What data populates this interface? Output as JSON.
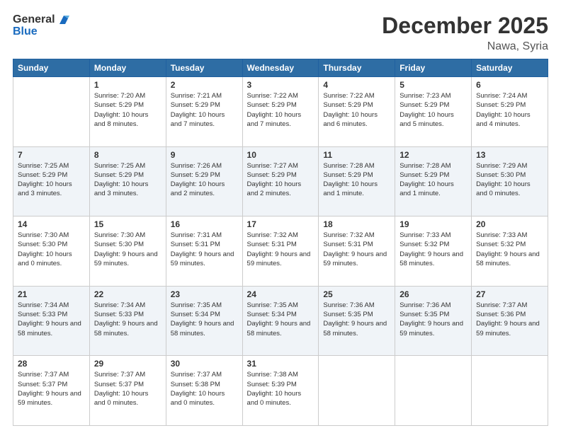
{
  "header": {
    "logo_line1": "General",
    "logo_line2": "Blue",
    "title": "December 2025",
    "location": "Nawa, Syria"
  },
  "weekdays": [
    "Sunday",
    "Monday",
    "Tuesday",
    "Wednesday",
    "Thursday",
    "Friday",
    "Saturday"
  ],
  "weeks": [
    [
      {
        "day": "",
        "sunrise": "",
        "sunset": "",
        "daylight": ""
      },
      {
        "day": "1",
        "sunrise": "Sunrise: 7:20 AM",
        "sunset": "Sunset: 5:29 PM",
        "daylight": "Daylight: 10 hours and 8 minutes."
      },
      {
        "day": "2",
        "sunrise": "Sunrise: 7:21 AM",
        "sunset": "Sunset: 5:29 PM",
        "daylight": "Daylight: 10 hours and 7 minutes."
      },
      {
        "day": "3",
        "sunrise": "Sunrise: 7:22 AM",
        "sunset": "Sunset: 5:29 PM",
        "daylight": "Daylight: 10 hours and 7 minutes."
      },
      {
        "day": "4",
        "sunrise": "Sunrise: 7:22 AM",
        "sunset": "Sunset: 5:29 PM",
        "daylight": "Daylight: 10 hours and 6 minutes."
      },
      {
        "day": "5",
        "sunrise": "Sunrise: 7:23 AM",
        "sunset": "Sunset: 5:29 PM",
        "daylight": "Daylight: 10 hours and 5 minutes."
      },
      {
        "day": "6",
        "sunrise": "Sunrise: 7:24 AM",
        "sunset": "Sunset: 5:29 PM",
        "daylight": "Daylight: 10 hours and 4 minutes."
      }
    ],
    [
      {
        "day": "7",
        "sunrise": "Sunrise: 7:25 AM",
        "sunset": "Sunset: 5:29 PM",
        "daylight": "Daylight: 10 hours and 3 minutes."
      },
      {
        "day": "8",
        "sunrise": "Sunrise: 7:25 AM",
        "sunset": "Sunset: 5:29 PM",
        "daylight": "Daylight: 10 hours and 3 minutes."
      },
      {
        "day": "9",
        "sunrise": "Sunrise: 7:26 AM",
        "sunset": "Sunset: 5:29 PM",
        "daylight": "Daylight: 10 hours and 2 minutes."
      },
      {
        "day": "10",
        "sunrise": "Sunrise: 7:27 AM",
        "sunset": "Sunset: 5:29 PM",
        "daylight": "Daylight: 10 hours and 2 minutes."
      },
      {
        "day": "11",
        "sunrise": "Sunrise: 7:28 AM",
        "sunset": "Sunset: 5:29 PM",
        "daylight": "Daylight: 10 hours and 1 minute."
      },
      {
        "day": "12",
        "sunrise": "Sunrise: 7:28 AM",
        "sunset": "Sunset: 5:29 PM",
        "daylight": "Daylight: 10 hours and 1 minute."
      },
      {
        "day": "13",
        "sunrise": "Sunrise: 7:29 AM",
        "sunset": "Sunset: 5:30 PM",
        "daylight": "Daylight: 10 hours and 0 minutes."
      }
    ],
    [
      {
        "day": "14",
        "sunrise": "Sunrise: 7:30 AM",
        "sunset": "Sunset: 5:30 PM",
        "daylight": "Daylight: 10 hours and 0 minutes."
      },
      {
        "day": "15",
        "sunrise": "Sunrise: 7:30 AM",
        "sunset": "Sunset: 5:30 PM",
        "daylight": "Daylight: 9 hours and 59 minutes."
      },
      {
        "day": "16",
        "sunrise": "Sunrise: 7:31 AM",
        "sunset": "Sunset: 5:31 PM",
        "daylight": "Daylight: 9 hours and 59 minutes."
      },
      {
        "day": "17",
        "sunrise": "Sunrise: 7:32 AM",
        "sunset": "Sunset: 5:31 PM",
        "daylight": "Daylight: 9 hours and 59 minutes."
      },
      {
        "day": "18",
        "sunrise": "Sunrise: 7:32 AM",
        "sunset": "Sunset: 5:31 PM",
        "daylight": "Daylight: 9 hours and 59 minutes."
      },
      {
        "day": "19",
        "sunrise": "Sunrise: 7:33 AM",
        "sunset": "Sunset: 5:32 PM",
        "daylight": "Daylight: 9 hours and 58 minutes."
      },
      {
        "day": "20",
        "sunrise": "Sunrise: 7:33 AM",
        "sunset": "Sunset: 5:32 PM",
        "daylight": "Daylight: 9 hours and 58 minutes."
      }
    ],
    [
      {
        "day": "21",
        "sunrise": "Sunrise: 7:34 AM",
        "sunset": "Sunset: 5:33 PM",
        "daylight": "Daylight: 9 hours and 58 minutes."
      },
      {
        "day": "22",
        "sunrise": "Sunrise: 7:34 AM",
        "sunset": "Sunset: 5:33 PM",
        "daylight": "Daylight: 9 hours and 58 minutes."
      },
      {
        "day": "23",
        "sunrise": "Sunrise: 7:35 AM",
        "sunset": "Sunset: 5:34 PM",
        "daylight": "Daylight: 9 hours and 58 minutes."
      },
      {
        "day": "24",
        "sunrise": "Sunrise: 7:35 AM",
        "sunset": "Sunset: 5:34 PM",
        "daylight": "Daylight: 9 hours and 58 minutes."
      },
      {
        "day": "25",
        "sunrise": "Sunrise: 7:36 AM",
        "sunset": "Sunset: 5:35 PM",
        "daylight": "Daylight: 9 hours and 58 minutes."
      },
      {
        "day": "26",
        "sunrise": "Sunrise: 7:36 AM",
        "sunset": "Sunset: 5:35 PM",
        "daylight": "Daylight: 9 hours and 59 minutes."
      },
      {
        "day": "27",
        "sunrise": "Sunrise: 7:37 AM",
        "sunset": "Sunset: 5:36 PM",
        "daylight": "Daylight: 9 hours and 59 minutes."
      }
    ],
    [
      {
        "day": "28",
        "sunrise": "Sunrise: 7:37 AM",
        "sunset": "Sunset: 5:37 PM",
        "daylight": "Daylight: 9 hours and 59 minutes."
      },
      {
        "day": "29",
        "sunrise": "Sunrise: 7:37 AM",
        "sunset": "Sunset: 5:37 PM",
        "daylight": "Daylight: 10 hours and 0 minutes."
      },
      {
        "day": "30",
        "sunrise": "Sunrise: 7:37 AM",
        "sunset": "Sunset: 5:38 PM",
        "daylight": "Daylight: 10 hours and 0 minutes."
      },
      {
        "day": "31",
        "sunrise": "Sunrise: 7:38 AM",
        "sunset": "Sunset: 5:39 PM",
        "daylight": "Daylight: 10 hours and 0 minutes."
      },
      {
        "day": "",
        "sunrise": "",
        "sunset": "",
        "daylight": ""
      },
      {
        "day": "",
        "sunrise": "",
        "sunset": "",
        "daylight": ""
      },
      {
        "day": "",
        "sunrise": "",
        "sunset": "",
        "daylight": ""
      }
    ]
  ]
}
